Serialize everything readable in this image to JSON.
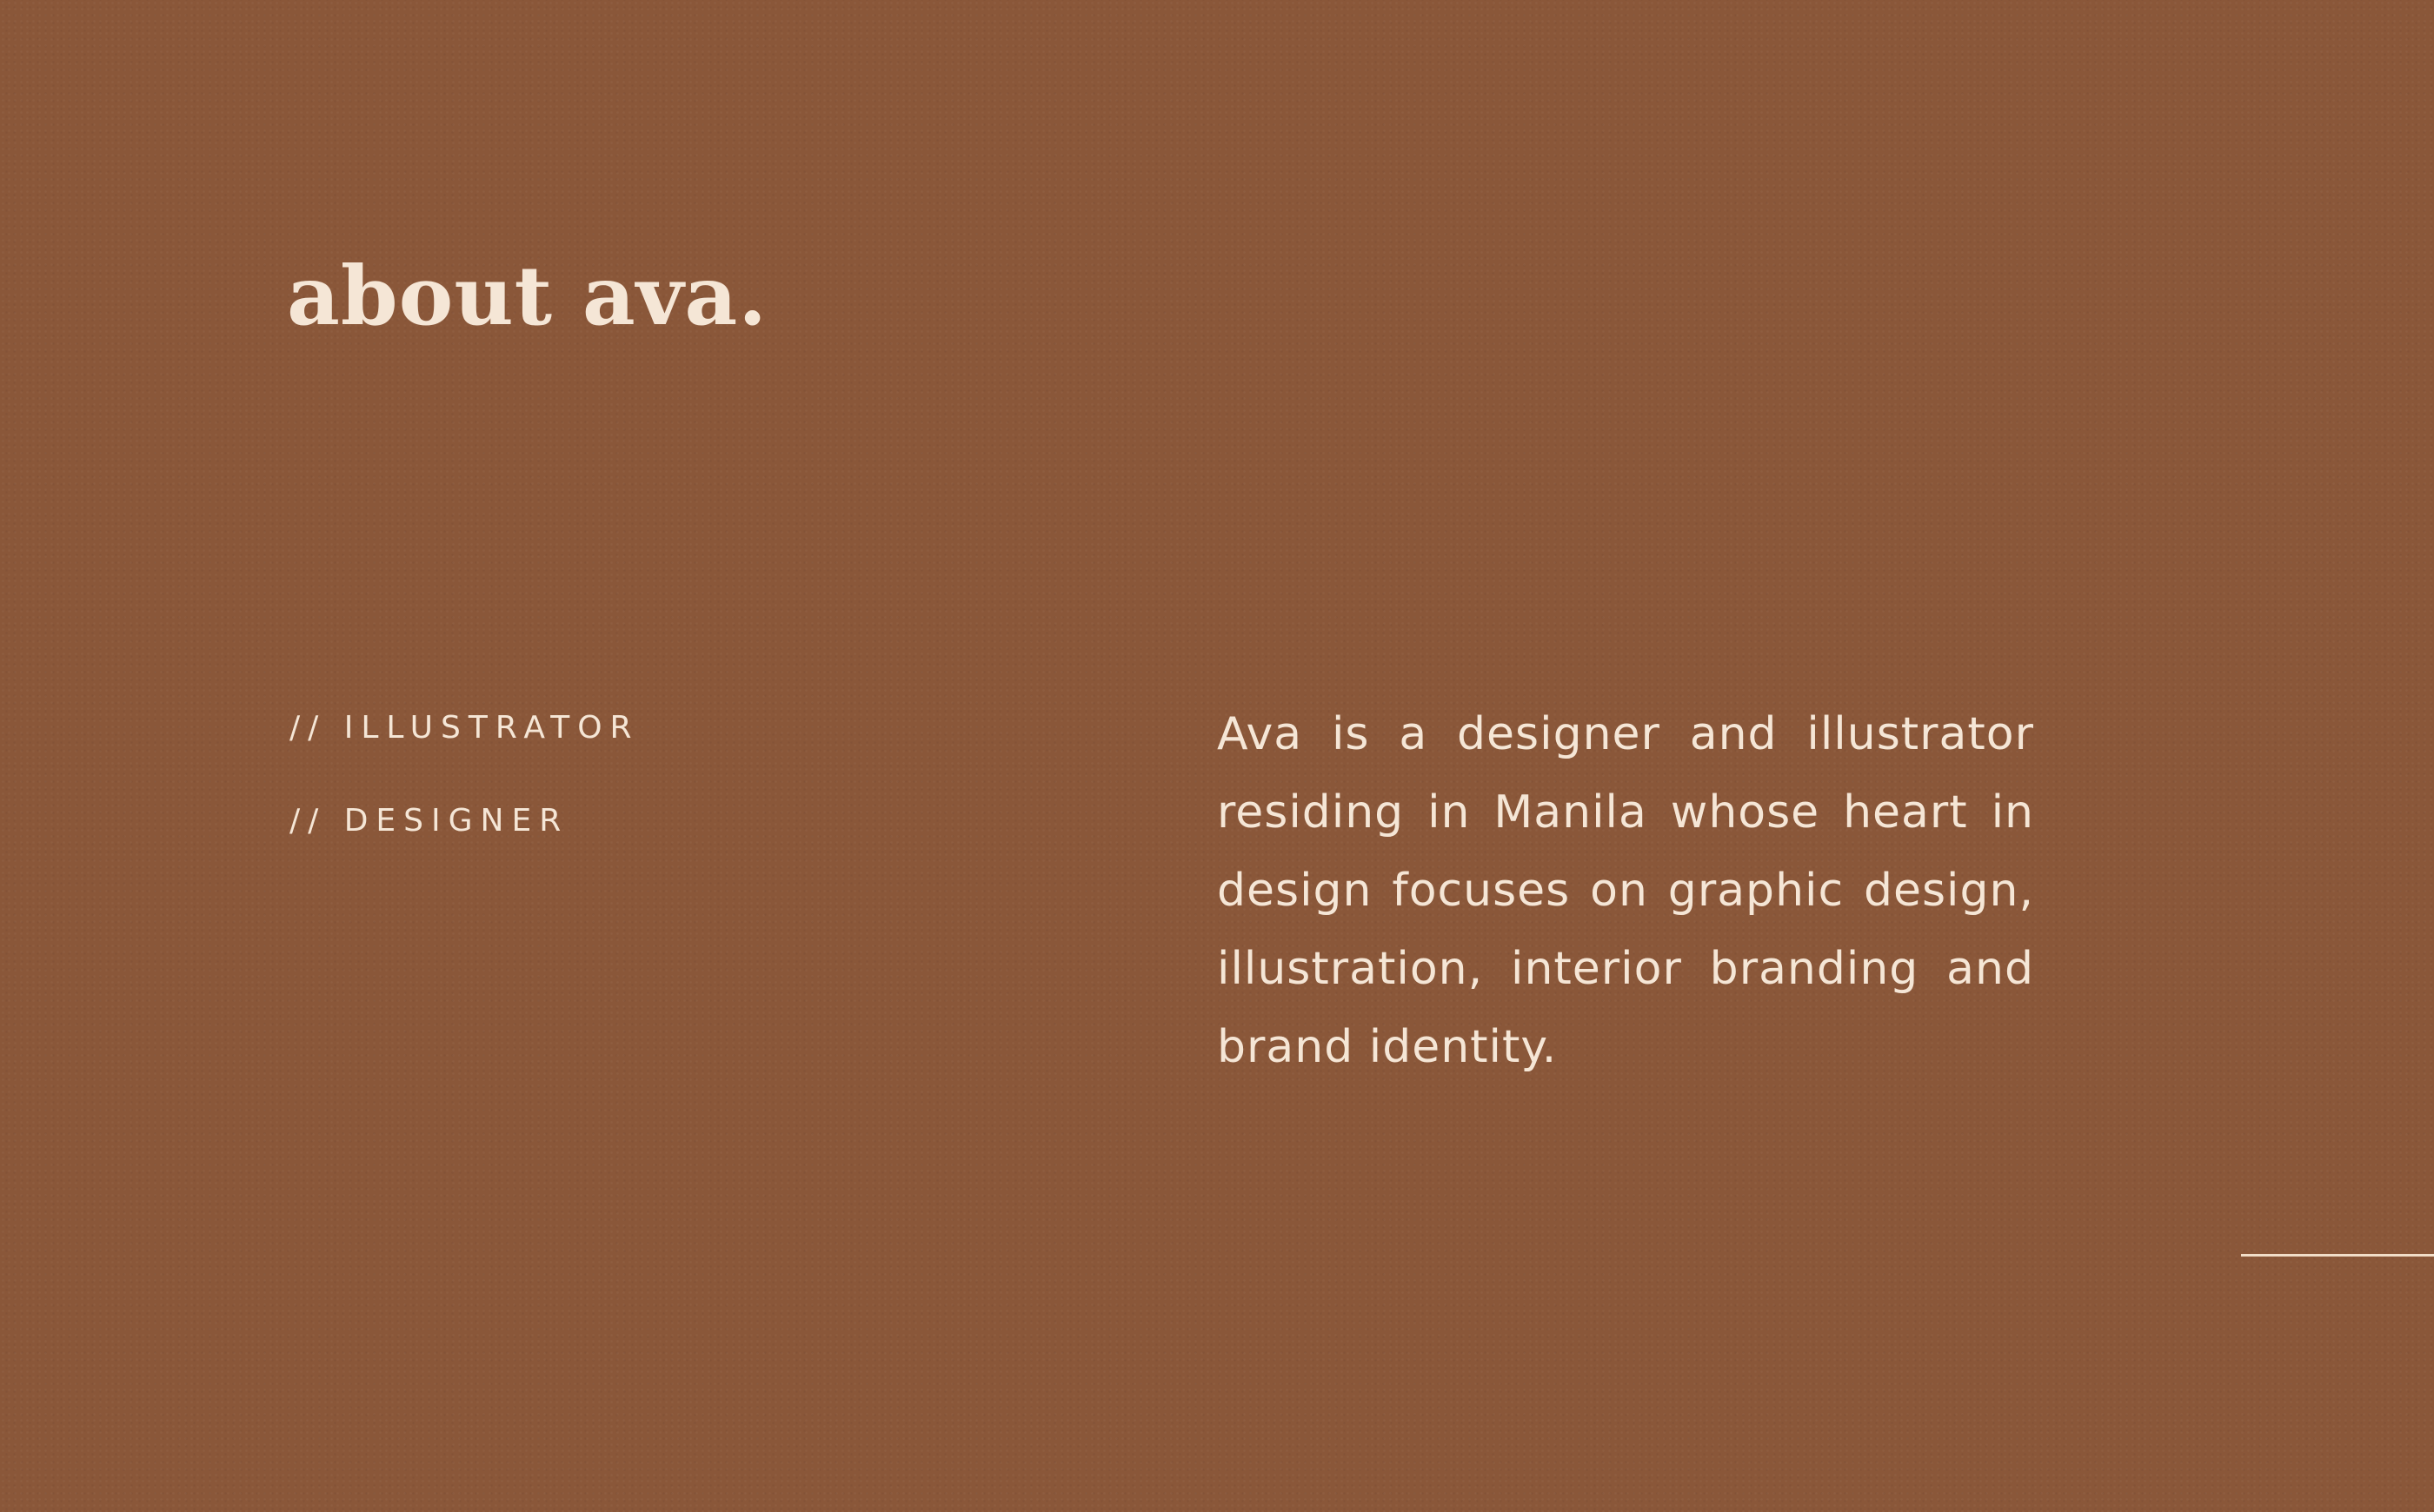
{
  "page": {
    "title": "about ava.",
    "roles": [
      "// ILLUSTRATOR",
      "// DESIGNER"
    ],
    "bio": "Ava is a designer and illustrator residing in Manila whose heart in design focuses on graphic design, illustration, interior branding and brand identity."
  },
  "colors": {
    "background": "#8a5739",
    "text": "#f5e6d6"
  }
}
